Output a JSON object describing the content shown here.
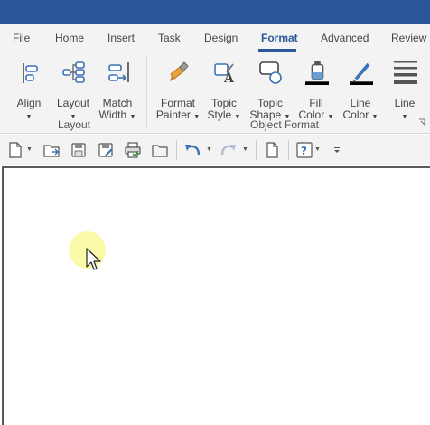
{
  "tabs": [
    {
      "label": "File"
    },
    {
      "label": "Home"
    },
    {
      "label": "Insert"
    },
    {
      "label": "Task"
    },
    {
      "label": "Design"
    },
    {
      "label": "Format"
    },
    {
      "label": "Advanced"
    },
    {
      "label": "Review"
    }
  ],
  "active_tab": "Format",
  "ribbon": {
    "layout_group": {
      "label": "Layout",
      "buttons": [
        {
          "line1": "Align",
          "line2": ""
        },
        {
          "line1": "Layout",
          "line2": ""
        },
        {
          "line1": "Match",
          "line2": "Width"
        }
      ]
    },
    "object_format_group": {
      "label": "Object Format",
      "buttons": [
        {
          "line1": "Format",
          "line2": "Painter"
        },
        {
          "line1": "Topic",
          "line2": "Style"
        },
        {
          "line1": "Topic",
          "line2": "Shape"
        },
        {
          "line1": "Fill",
          "line2": "Color"
        },
        {
          "line1": "Line",
          "line2": "Color"
        },
        {
          "line1": "Line",
          "line2": ""
        }
      ]
    }
  },
  "colors": {
    "title_bar": "#2b579a",
    "accent": "#2b579a",
    "ribbon_bg": "#f3f3f3",
    "fill_color_swatch": "#000000",
    "line_color_swatch": "#000000",
    "cursor_highlight": "#fbfa9e"
  },
  "quick_access_toolbar": {
    "icons": [
      "new-document-icon",
      "open-icon",
      "save-icon",
      "save-as-icon",
      "print-icon",
      "open-folder-icon",
      "undo-icon",
      "redo-icon",
      "page-icon",
      "help-icon",
      "customize-icon"
    ]
  }
}
